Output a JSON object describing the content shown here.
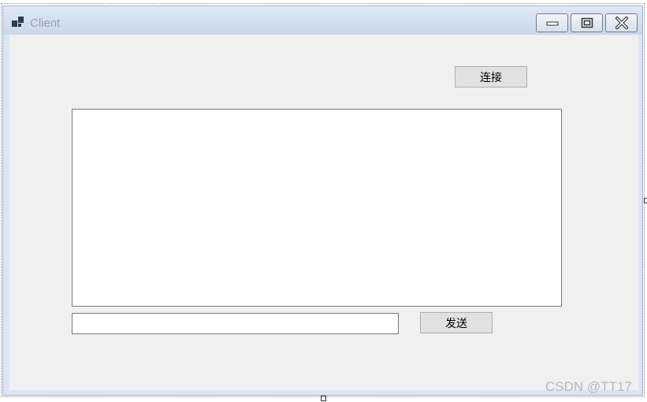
{
  "window": {
    "title": "Client"
  },
  "titlebar_buttons": [
    {
      "name": "minimize-button",
      "icon": "minimize-icon"
    },
    {
      "name": "maximize-button",
      "icon": "maximize-icon"
    },
    {
      "name": "close-button",
      "icon": "close-icon"
    }
  ],
  "connect_button": {
    "label": "连接"
  },
  "message_log": {
    "value": ""
  },
  "message_input": {
    "value": "",
    "placeholder": ""
  },
  "send_button": {
    "label": "发送"
  },
  "watermark": {
    "text": "CSDN @TT17"
  }
}
